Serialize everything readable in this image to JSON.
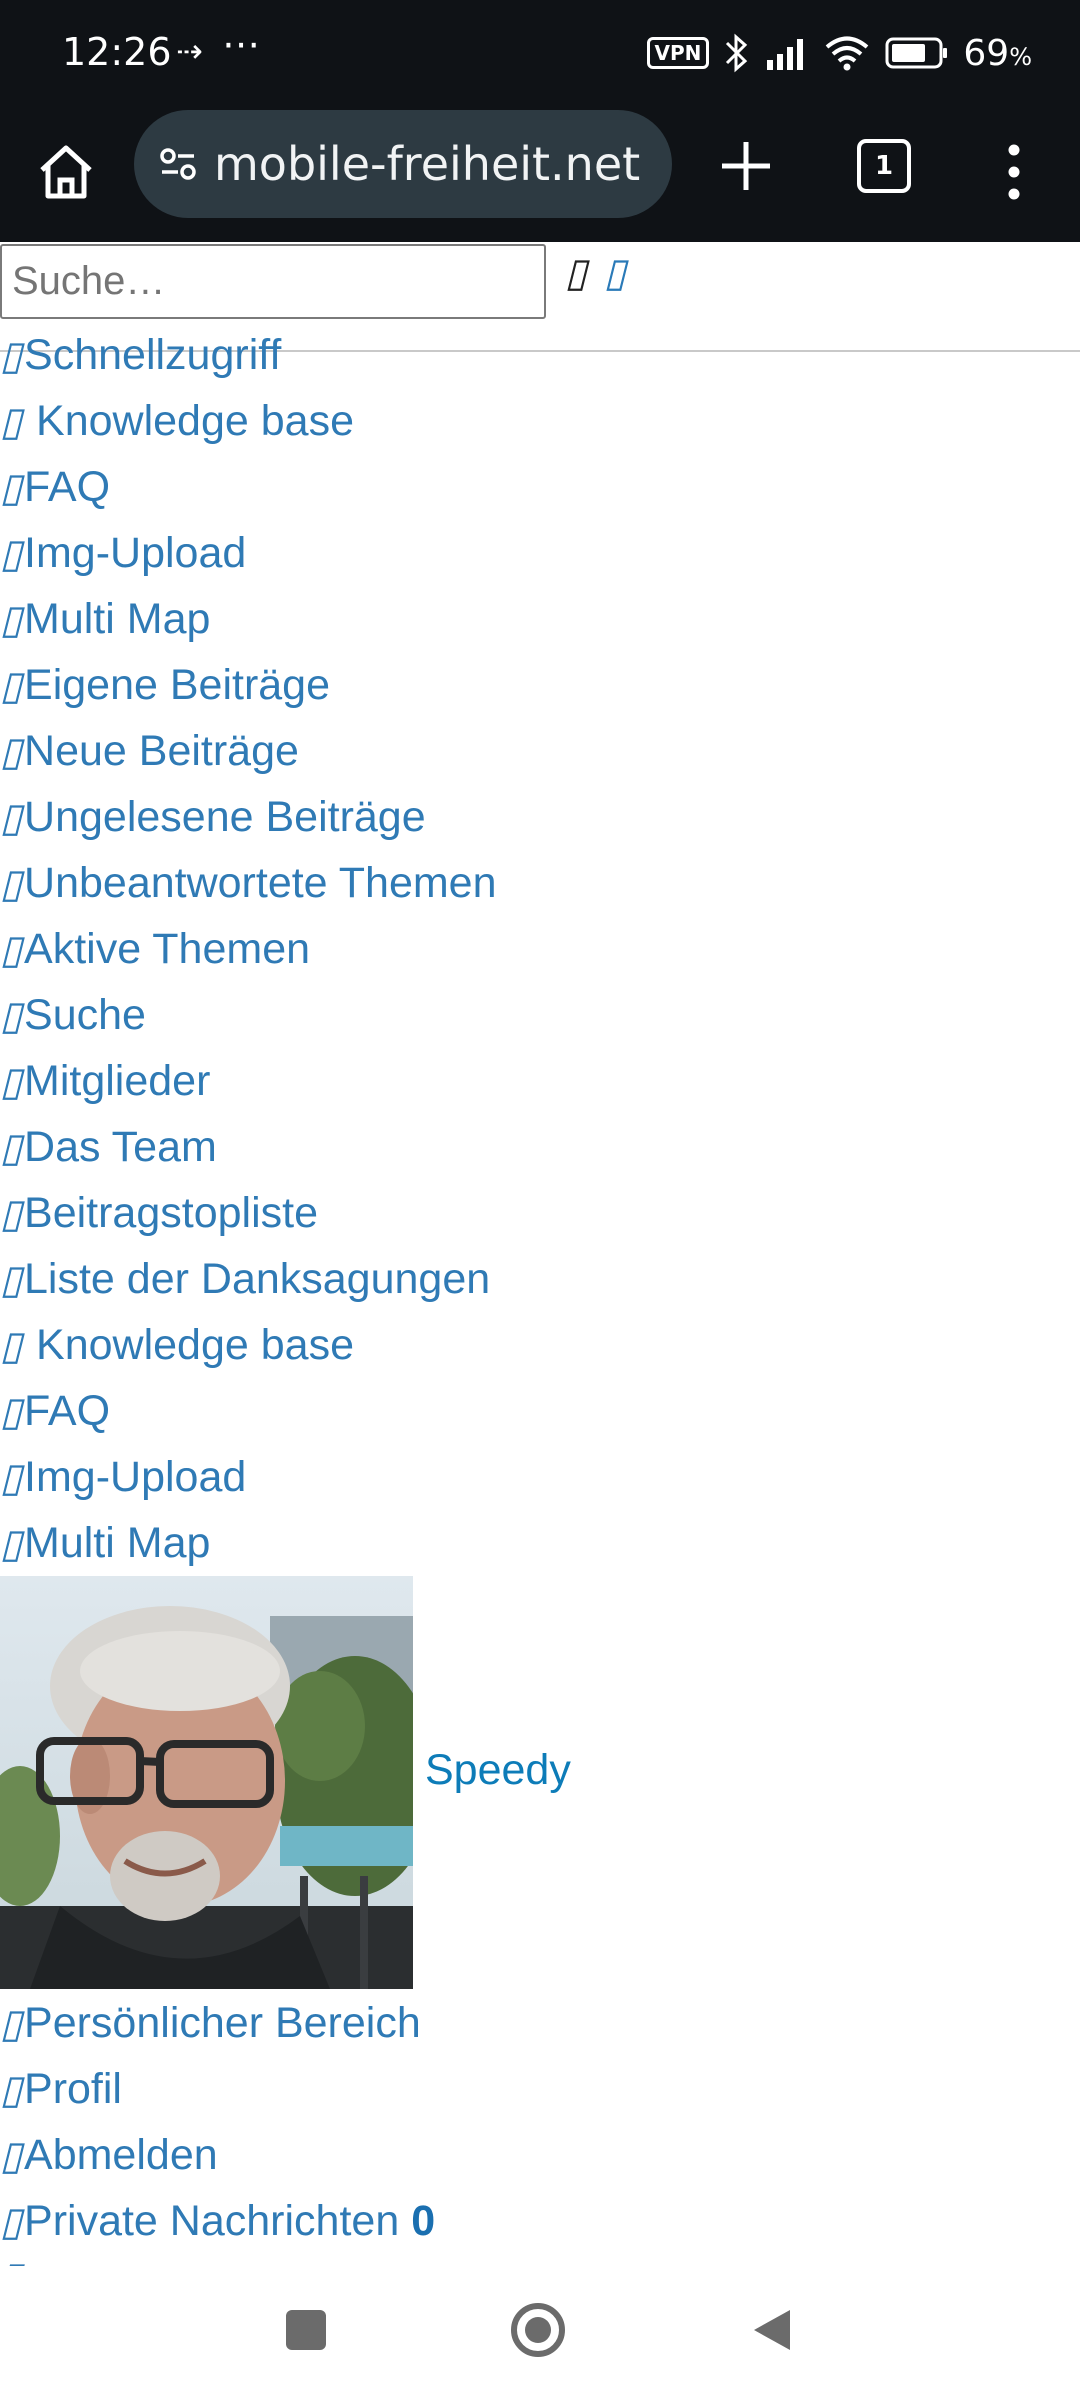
{
  "status_bar": {
    "time": "12:26",
    "vpn_label": "VPN",
    "battery_percent": "69",
    "battery_unit": "%"
  },
  "browser": {
    "url": "mobile-freiheit.net",
    "tab_count": "1"
  },
  "search": {
    "placeholder": "Suche…"
  },
  "nav_links": [
    {
      "label": "Schnellzugriff"
    },
    {
      "label": "Knowledge base"
    },
    {
      "label": "FAQ"
    },
    {
      "label": "Img-Upload"
    },
    {
      "label": "Multi Map"
    },
    {
      "label": "Eigene Beiträge"
    },
    {
      "label": "Neue Beiträge"
    },
    {
      "label": "Ungelesene Beiträge"
    },
    {
      "label": "Unbeantwortete Themen"
    },
    {
      "label": "Aktive Themen"
    },
    {
      "label": "Suche"
    },
    {
      "label": "Mitglieder"
    },
    {
      "label": "Das Team"
    },
    {
      "label": "Beitragstopliste"
    },
    {
      "label": "Liste der Danksagungen"
    },
    {
      "label": "Knowledge base"
    },
    {
      "label": "FAQ"
    },
    {
      "label": "Img-Upload"
    },
    {
      "label": "Multi Map"
    }
  ],
  "user": {
    "name": "Speedy"
  },
  "user_links": [
    {
      "label": "Persönlicher Bereich"
    },
    {
      "label": "Profil"
    },
    {
      "label": "Abmelden"
    }
  ],
  "private_messages": {
    "label": "Private Nachrichten",
    "count": "0"
  }
}
